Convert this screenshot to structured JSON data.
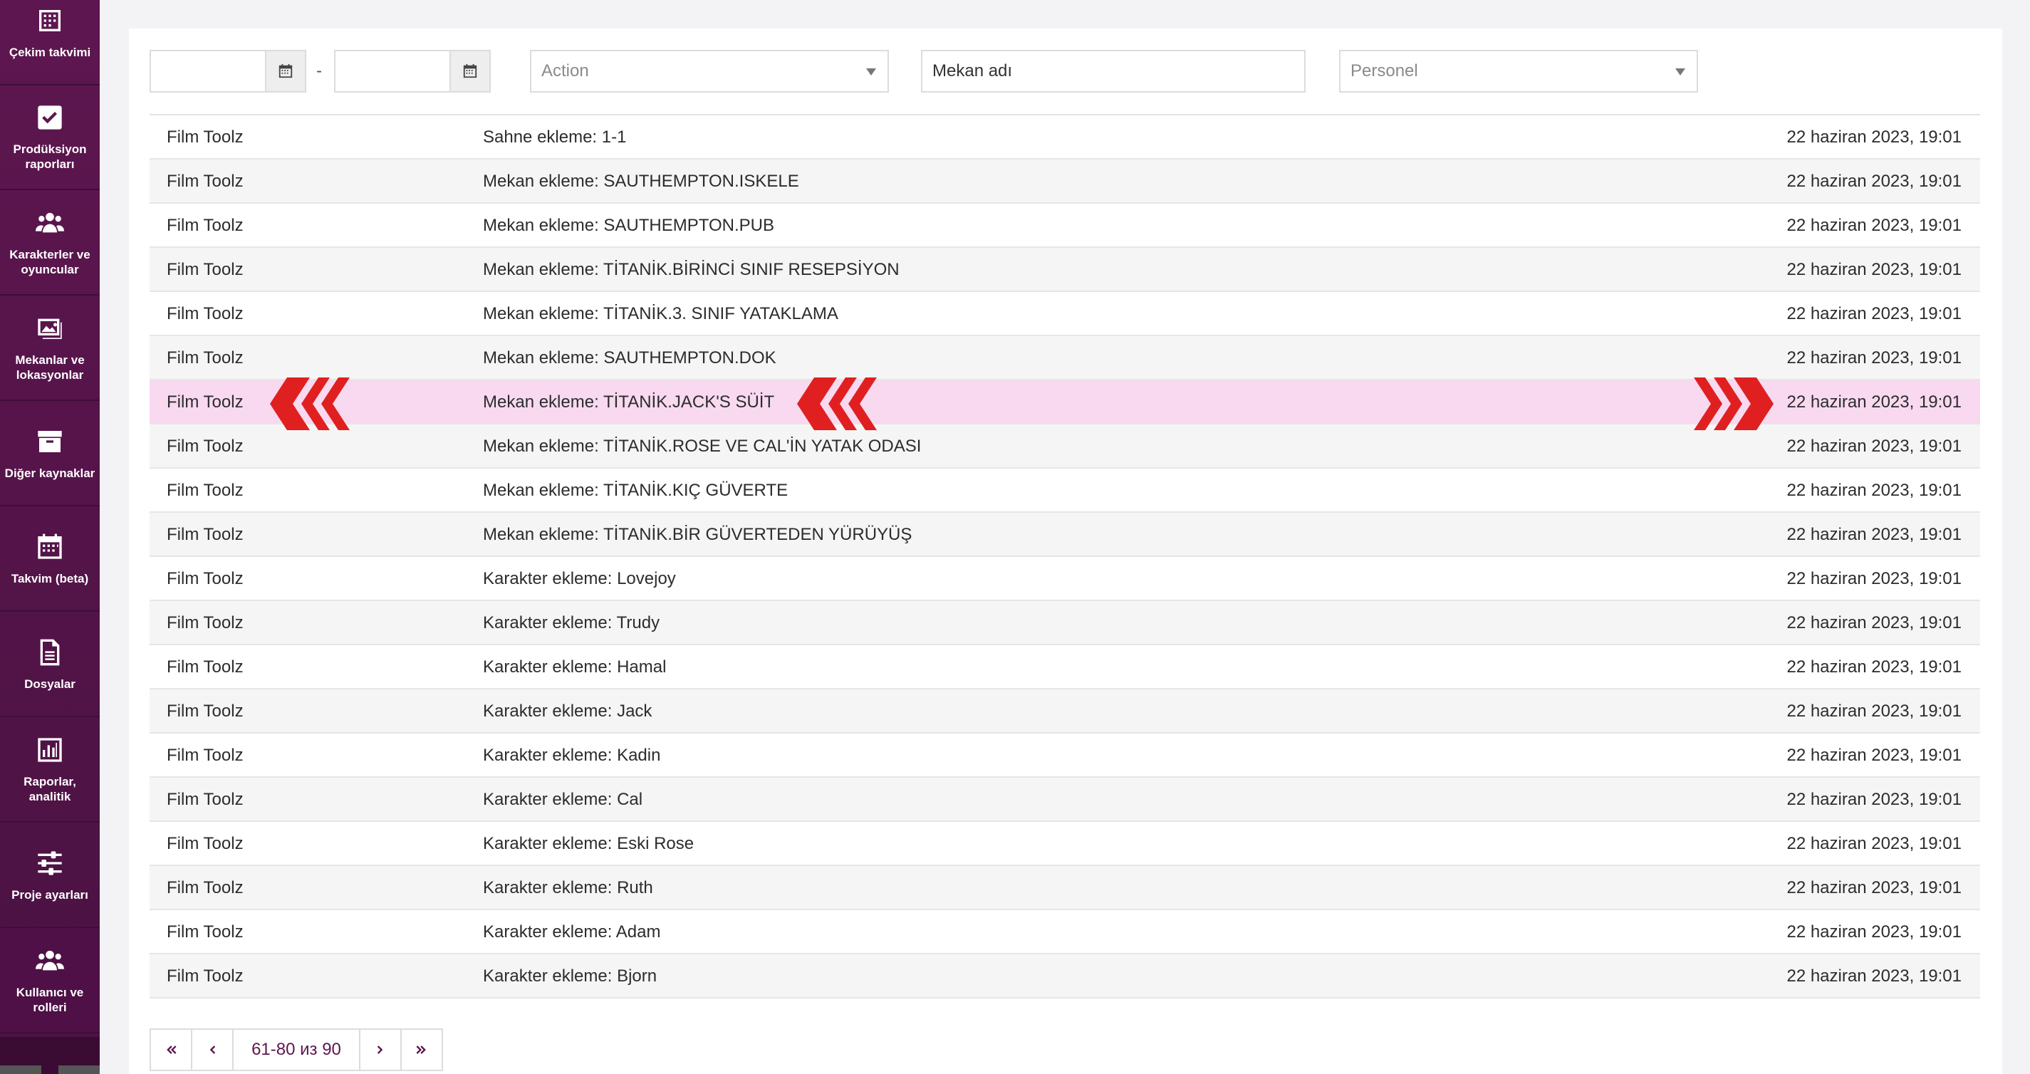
{
  "sidebar": {
    "items": [
      {
        "label": "Çekim takvimi",
        "icon": "calendar-grid-icon"
      },
      {
        "label": "Prodüksiyon raporları",
        "icon": "checkbox-icon"
      },
      {
        "label": "Karakterler ve oyuncular",
        "icon": "users-icon"
      },
      {
        "label": "Mekanlar ve lokasyonlar",
        "icon": "image-icon"
      },
      {
        "label": "Diğer kaynaklar",
        "icon": "archive-icon"
      },
      {
        "label": "Takvim (beta)",
        "icon": "calendar-icon"
      },
      {
        "label": "Dosyalar",
        "icon": "file-icon"
      },
      {
        "label": "Raporlar, analitik",
        "icon": "bar-chart-icon"
      },
      {
        "label": "Proje ayarları",
        "icon": "sliders-icon"
      },
      {
        "label": "Kullanıcı ve rolleri",
        "icon": "users-icon"
      }
    ]
  },
  "filters": {
    "date_from_value": "",
    "date_to_value": "",
    "separator": "-",
    "action_placeholder": "Action",
    "location_value": "Mekan adı",
    "personnel_placeholder": "Personel"
  },
  "log": {
    "rows": [
      {
        "user": "Film Toolz",
        "action": "Sahne ekleme: 1-1",
        "date": "22 haziran 2023, 19:01"
      },
      {
        "user": "Film Toolz",
        "action": "Mekan ekleme: SAUTHEMPTON.ISKELE",
        "date": "22 haziran 2023, 19:01"
      },
      {
        "user": "Film Toolz",
        "action": "Mekan ekleme: SAUTHEMPTON.PUB",
        "date": "22 haziran 2023, 19:01"
      },
      {
        "user": "Film Toolz",
        "action": "Mekan ekleme: TİTANİK.BİRİNCİ SINIF RESEPSİYON",
        "date": "22 haziran 2023, 19:01"
      },
      {
        "user": "Film Toolz",
        "action": "Mekan ekleme: TİTANİK.3. SINIF YATAKLAMA",
        "date": "22 haziran 2023, 19:01"
      },
      {
        "user": "Film Toolz",
        "action": "Mekan ekleme: SAUTHEMPTON.DOK",
        "date": "22 haziran 2023, 19:01"
      },
      {
        "user": "Film Toolz",
        "action": "Mekan ekleme: TİTANİK.JACK'S SÜİT",
        "date": "22 haziran 2023, 19:01",
        "highlighted": true
      },
      {
        "user": "Film Toolz",
        "action": "Mekan ekleme: TİTANİK.ROSE VE CAL'İN YATAK ODASI",
        "date": "22 haziran 2023, 19:01"
      },
      {
        "user": "Film Toolz",
        "action": "Mekan ekleme: TİTANİK.KIÇ GÜVERTE",
        "date": "22 haziran 2023, 19:01"
      },
      {
        "user": "Film Toolz",
        "action": "Mekan ekleme: TİTANİK.BİR GÜVERTEDEN YÜRÜYÜŞ",
        "date": "22 haziran 2023, 19:01"
      },
      {
        "user": "Film Toolz",
        "action": "Karakter ekleme: Lovejoy",
        "date": "22 haziran 2023, 19:01"
      },
      {
        "user": "Film Toolz",
        "action": "Karakter ekleme: Trudy",
        "date": "22 haziran 2023, 19:01"
      },
      {
        "user": "Film Toolz",
        "action": "Karakter ekleme: Hamal",
        "date": "22 haziran 2023, 19:01"
      },
      {
        "user": "Film Toolz",
        "action": "Karakter ekleme: Jack",
        "date": "22 haziran 2023, 19:01"
      },
      {
        "user": "Film Toolz",
        "action": "Karakter ekleme: Kadin",
        "date": "22 haziran 2023, 19:01"
      },
      {
        "user": "Film Toolz",
        "action": "Karakter ekleme: Cal",
        "date": "22 haziran 2023, 19:01"
      },
      {
        "user": "Film Toolz",
        "action": "Karakter ekleme: Eski Rose",
        "date": "22 haziran 2023, 19:01"
      },
      {
        "user": "Film Toolz",
        "action": "Karakter ekleme: Ruth",
        "date": "22 haziran 2023, 19:01"
      },
      {
        "user": "Film Toolz",
        "action": "Karakter ekleme: Adam",
        "date": "22 haziran 2023, 19:01"
      },
      {
        "user": "Film Toolz",
        "action": "Karakter ekleme: Bjorn",
        "date": "22 haziran 2023, 19:01"
      }
    ]
  },
  "pagination": {
    "range_label": "61-80 из 90"
  },
  "colors": {
    "sidebar": "#5e1650",
    "highlight_row": "#f8d9f0",
    "arrow": "#e02020",
    "accent": "#5e1650"
  }
}
